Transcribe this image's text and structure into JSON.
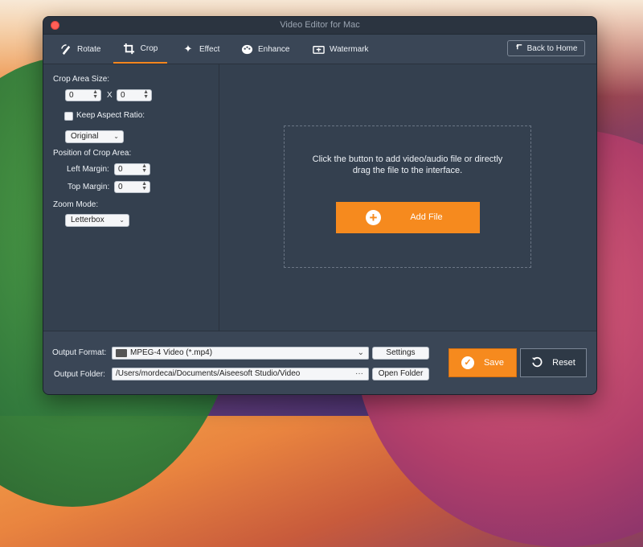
{
  "window": {
    "title": "Video Editor for Mac"
  },
  "tabs": [
    {
      "label": "Rotate",
      "icon": "rotate-icon"
    },
    {
      "label": "Crop",
      "icon": "crop-icon",
      "active": true
    },
    {
      "label": "Effect",
      "icon": "effect-icon"
    },
    {
      "label": "Enhance",
      "icon": "enhance-icon"
    },
    {
      "label": "Watermark",
      "icon": "watermark-icon"
    }
  ],
  "back_home": {
    "label": "Back to Home",
    "icon": "back-arrow-icon"
  },
  "crop": {
    "area_size_label": "Crop Area Size:",
    "width": "0",
    "separator": "X",
    "height": "0",
    "keep_aspect_label": "Keep Aspect Ratio:",
    "keep_aspect_checked": false,
    "aspect_value": "Original",
    "position_label": "Position of Crop Area:",
    "left_margin_label": "Left Margin:",
    "left_margin": "0",
    "top_margin_label": "Top Margin:",
    "top_margin": "0",
    "zoom_label": "Zoom Mode:",
    "zoom_value": "Letterbox"
  },
  "drop": {
    "line1": "Click the button to add video/audio file or directly",
    "line2": "drag the file to the interface.",
    "add_label": "Add File"
  },
  "output": {
    "format_label": "Output Format:",
    "format_value": "MPEG-4 Video (*.mp4)",
    "settings_label": "Settings",
    "folder_label": "Output Folder:",
    "folder_value": "/Users/mordecai/Documents/Aiseesoft Studio/Video",
    "folder_dots": "···",
    "open_folder_label": "Open Folder",
    "save_label": "Save",
    "reset_label": "Reset"
  },
  "colors": {
    "accent": "#f68a1e",
    "panel": "#34404f",
    "toolbar": "#3a4656"
  }
}
